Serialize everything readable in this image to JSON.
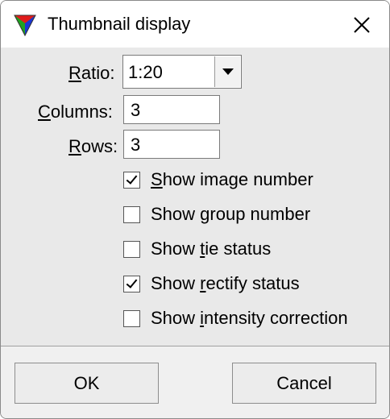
{
  "window": {
    "title": "Thumbnail display",
    "close_icon": "close-icon",
    "app_icon": "tricolor-triangle-icon"
  },
  "form": {
    "ratio": {
      "label_u": "R",
      "label_rest": "atio:",
      "value": "1:20",
      "dropdown_icon": "triangle-down-icon"
    },
    "columns": {
      "label_u": "C",
      "label_rest": "olumns:",
      "value": "3"
    },
    "rows": {
      "label_u": "R",
      "label_rest": "ows:",
      "value": "3"
    }
  },
  "options": [
    {
      "pre": "",
      "u": "S",
      "post": "how image number",
      "checked": true
    },
    {
      "pre": "Show ",
      "u": "g",
      "post": "roup number",
      "checked": false
    },
    {
      "pre": "Show ",
      "u": "t",
      "post": "ie status",
      "checked": false
    },
    {
      "pre": "Show ",
      "u": "r",
      "post": "ectify status",
      "checked": true
    },
    {
      "pre": "Show ",
      "u": "i",
      "post": "ntensity correction",
      "checked": false
    }
  ],
  "buttons": {
    "ok": "OK",
    "cancel": "Cancel"
  }
}
